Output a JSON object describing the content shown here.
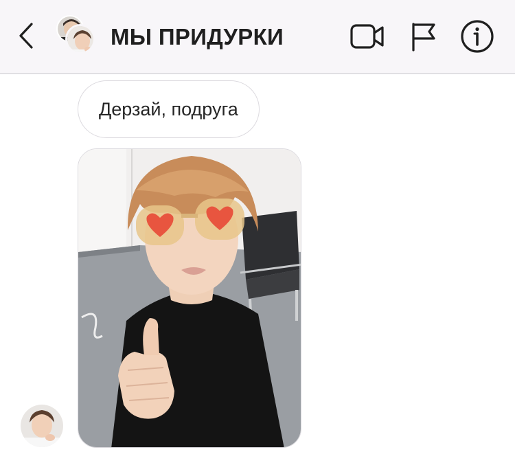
{
  "header": {
    "title": "МЫ ПРИДУРКИ"
  },
  "messages": [
    {
      "type": "text",
      "text": "Дерзай, подруга"
    },
    {
      "type": "photo"
    }
  ],
  "icons": {
    "back": "chevron-left-icon",
    "video": "video-camera-icon",
    "report": "flag-icon",
    "info": "info-icon"
  },
  "colors": {
    "header_bg": "#f8f6f9",
    "divider": "#c9c9cc",
    "icon": "#1f1f1f",
    "bubble_border": "#dcdadf",
    "text": "#262626"
  }
}
